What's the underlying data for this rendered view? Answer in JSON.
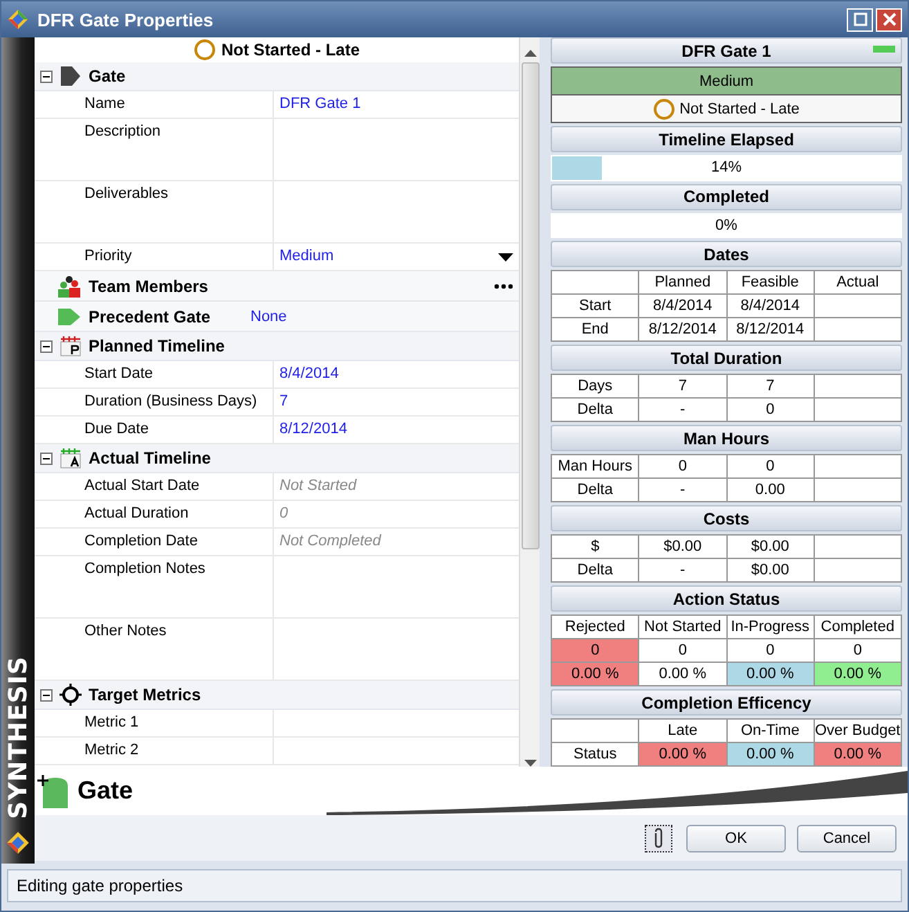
{
  "window": {
    "title": "DFR Gate Properties"
  },
  "brand": "SYNTHESIS",
  "property_grid": {
    "status": "Not Started - Late",
    "sections": [
      {
        "kind": "category",
        "label": "Gate",
        "expanded": true,
        "rows": [
          {
            "label": "Name",
            "value": "DFR Gate 1",
            "kind": "text",
            "readonly": false
          },
          {
            "label": "Description",
            "kind": "multiline"
          },
          {
            "label": "Deliverables",
            "kind": "multiline"
          },
          {
            "label": "Priority",
            "value": "Medium",
            "kind": "dropdown",
            "readonly": false
          }
        ]
      },
      {
        "kind": "item",
        "label": "Team Members",
        "has_ellipsis": true
      },
      {
        "kind": "item",
        "label": "Precedent Gate",
        "value": "None"
      },
      {
        "kind": "category",
        "label": "Planned Timeline",
        "expanded": true,
        "rows": [
          {
            "label": "Start Date",
            "value": "8/4/2014",
            "kind": "text",
            "readonly": false
          },
          {
            "label": "Duration (Business Days)",
            "value": "7",
            "kind": "text",
            "readonly": false
          },
          {
            "label": "Due Date",
            "value": "8/12/2014",
            "kind": "text",
            "readonly": false
          }
        ]
      },
      {
        "kind": "category",
        "label": "Actual Timeline",
        "expanded": true,
        "rows": [
          {
            "label": "Actual Start Date",
            "value": "Not Started",
            "kind": "text",
            "readonly": true
          },
          {
            "label": "Actual Duration",
            "value": "0",
            "kind": "text",
            "readonly": true
          },
          {
            "label": "Completion Date",
            "value": "Not Completed",
            "kind": "text",
            "readonly": true
          },
          {
            "label": "Completion Notes",
            "kind": "multiline"
          },
          {
            "label": "Other Notes",
            "kind": "multiline"
          }
        ]
      },
      {
        "kind": "category",
        "label": "Target Metrics",
        "expanded": true,
        "rows": [
          {
            "label": "Metric 1",
            "kind": "text"
          },
          {
            "label": "Metric 2",
            "kind": "text"
          }
        ]
      }
    ]
  },
  "summary": {
    "title": "DFR Gate 1",
    "priority": "Medium",
    "status": "Not Started - Late",
    "sections": [
      {
        "kind": "bar",
        "title": "Timeline Elapsed",
        "level": 0.14,
        "reading": "14%"
      },
      {
        "kind": "text",
        "title": "Completed",
        "reading": "0%"
      },
      {
        "kind": "table",
        "title": "Dates",
        "header": [
          "Planned",
          "Feasible",
          "Actual"
        ],
        "rows": [
          [
            "Start",
            "8/4/2014",
            "8/4/2014",
            ""
          ],
          [
            "End",
            "8/12/2014",
            "8/12/2014",
            ""
          ]
        ]
      },
      {
        "kind": "table",
        "title": "Total Duration",
        "rows": [
          [
            "Days",
            "7",
            "7",
            ""
          ],
          [
            "Delta",
            "-",
            "0",
            ""
          ]
        ]
      },
      {
        "kind": "table",
        "title": "Man Hours",
        "rows": [
          [
            "Man Hours",
            "0",
            "0",
            ""
          ],
          [
            "Delta",
            "-",
            "0.00",
            ""
          ]
        ]
      },
      {
        "kind": "table",
        "title": "Costs",
        "rows": [
          [
            "$",
            "$0.00",
            "$0.00",
            ""
          ],
          [
            "Delta",
            "-",
            "$0.00",
            ""
          ]
        ]
      },
      {
        "kind": "table",
        "title": "Action Status",
        "header": [
          "Rejected",
          "Not Started",
          "In-Progress",
          "Completed"
        ],
        "rows": [
          [
            {
              "text": "0",
              "color": "#f08080"
            },
            "0",
            "0",
            "0"
          ],
          [
            {
              "text": "0.00 %",
              "color": "#f08080"
            },
            "0.00 %",
            {
              "text": "0.00 %",
              "color": "#add8e6"
            },
            {
              "text": "0.00 %",
              "color": "#90ee90"
            }
          ]
        ]
      },
      {
        "kind": "table",
        "title": "Completion Efficency",
        "header": [
          "Late",
          "On-Time",
          "Over Budget"
        ],
        "rows": [
          [
            "Status",
            {
              "text": "0.00 %",
              "color": "#f08080"
            },
            {
              "text": "0.00 %",
              "color": "#add8e6"
            },
            {
              "text": "0.00 %",
              "color": "#f08080"
            }
          ]
        ]
      }
    ]
  },
  "banner": {
    "title": "Gate"
  },
  "buttons": [
    {
      "kind": "attach"
    },
    {
      "kind": "text",
      "label": "OK"
    },
    {
      "kind": "text",
      "label": "Cancel"
    }
  ],
  "status_bar": "Editing gate properties"
}
